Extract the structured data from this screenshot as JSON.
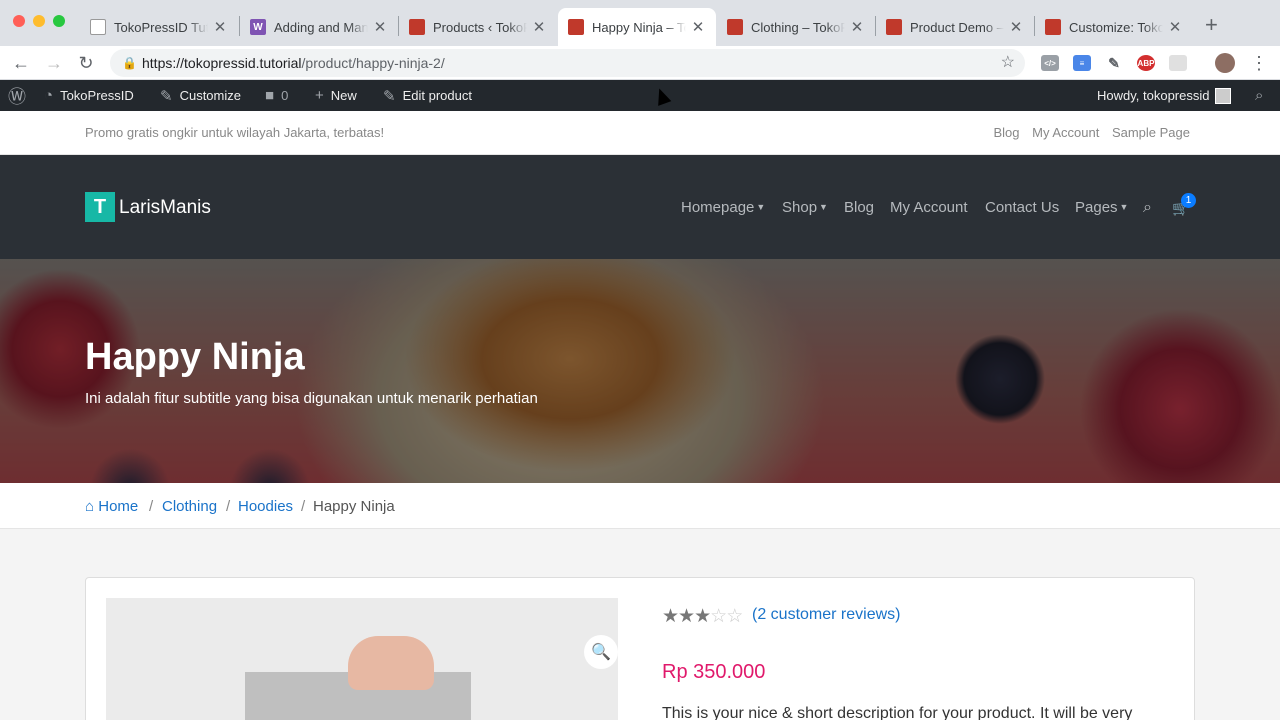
{
  "browser": {
    "tabs": [
      {
        "title": "TokoPressID Tutorial",
        "favicon": "document-icon",
        "active": false
      },
      {
        "title": "Adding and Managing Products",
        "favicon": "woocommerce-icon",
        "active": false
      },
      {
        "title": "Products ‹ TokoPressID",
        "favicon": "tokopress-icon",
        "active": false
      },
      {
        "title": "Happy Ninja – TokoPressID",
        "favicon": "tokopress-icon",
        "active": true
      },
      {
        "title": "Clothing – TokoPressID",
        "favicon": "tokopress-icon",
        "active": false
      },
      {
        "title": "Product Demo – TokoPressID",
        "favicon": "tokopress-icon",
        "active": false
      },
      {
        "title": "Customize: TokoPressID",
        "favicon": "tokopress-icon",
        "active": false
      }
    ],
    "url_host": "https://tokopressid.tutorial",
    "url_path": "/product/happy-ninja-2/"
  },
  "wp_admin_bar": {
    "site_name": "TokoPressID",
    "customize": "Customize",
    "comments_count": "0",
    "new": "New",
    "edit_product": "Edit product",
    "howdy": "Howdy, tokopressid"
  },
  "topbar": {
    "promo": "Promo gratis ongkir untuk wilayah Jakarta, terbatas!",
    "links": [
      "Blog",
      "My Account",
      "Sample Page"
    ]
  },
  "header": {
    "logo_letter": "T",
    "site_title": "LarisManis",
    "menu": [
      "Homepage",
      "Shop",
      "Blog",
      "My Account",
      "Contact Us",
      "Pages"
    ],
    "cart_count": "1"
  },
  "hero": {
    "title": "Happy Ninja",
    "subtitle": "Ini adalah fitur subtitle yang bisa digunakan untuk menarik perhatian"
  },
  "breadcrumb": {
    "home": "Home",
    "category": "Clothing",
    "subcategory": "Hoodies",
    "current": "Happy Ninja",
    "separator": "/"
  },
  "product": {
    "rating": 3,
    "rating_max": 5,
    "reviews": "(2 customer reviews)",
    "price": "Rp 350.000",
    "short_description": "This is your nice & short description for your product. It will be very"
  },
  "colors": {
    "accent_link": "#1a73c9",
    "price": "#e0196b",
    "logo": "#17b8a6",
    "header_bg": "#2b3036"
  }
}
